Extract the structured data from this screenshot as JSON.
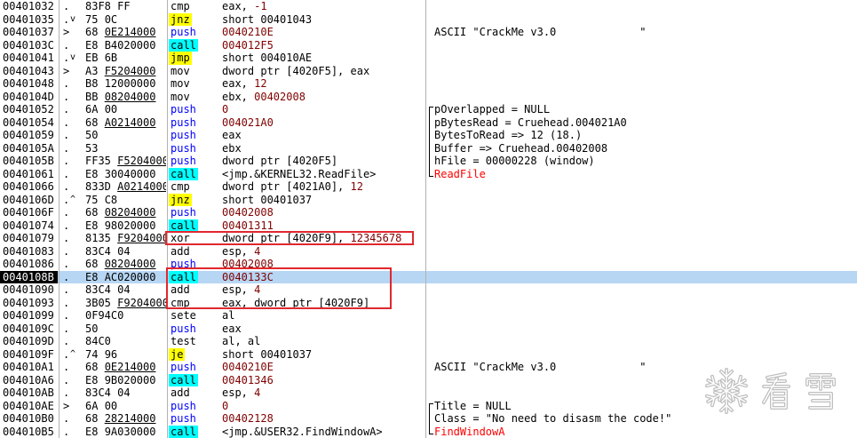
{
  "colors": {
    "push_mnemonic": "#0000FF",
    "call_background": "#00FFFF",
    "jump_background": "#FFFF00",
    "constant_operand": "#800000",
    "api_name_comment": "#FF0000",
    "selected_row": "#B7D6F3",
    "selected_address_background": "#000000",
    "annotation_box": "#E0282E"
  },
  "watermark": {
    "text": "看雪",
    "icon": "snowflake-icon"
  },
  "rows": [
    {
      "addr": "00401032",
      "m": ".",
      "hex": "83F8",
      "arg": "FF",
      "mn": "cmp",
      "ops": "eax, ",
      "imm": "-1"
    },
    {
      "addr": "00401035",
      "m": ".",
      "arr": "down-arrow-icon",
      "hex": "75",
      "arg": "0C",
      "mn": "jnz",
      "ops": "short 00401043",
      "imm": ""
    },
    {
      "addr": "00401037",
      "m": ">",
      "hex": "68",
      "arg": "0E214000",
      "fix": true,
      "mn": "push",
      "ops": "",
      "imm": "0040210E",
      "cmt": "ASCII \"CrackMe v3.0             \""
    },
    {
      "addr": "0040103C",
      "m": ".",
      "hex": "E8",
      "arg": "B4020000",
      "mn": "call",
      "ops": "",
      "imm": "004012F5"
    },
    {
      "addr": "00401041",
      "m": ".",
      "arr": "down-arrow-icon",
      "hex": "EB",
      "arg": "6B",
      "mn": "jmp",
      "ops": "short 004010AE",
      "imm": ""
    },
    {
      "addr": "00401043",
      "m": ">",
      "hex": "A3",
      "arg": "F5204000",
      "fix": true,
      "mn": "mov",
      "ops": "dword ptr [4020F5], eax",
      "imm": ""
    },
    {
      "addr": "00401048",
      "m": ".",
      "hex": "B8",
      "arg": "12000000",
      "mn": "mov",
      "ops": "eax, ",
      "imm": "12"
    },
    {
      "addr": "0040104D",
      "m": ".",
      "hex": "BB",
      "arg": "08204000",
      "fix": true,
      "mn": "mov",
      "ops": "ebx, ",
      "imm": "00402008"
    },
    {
      "addr": "00401052",
      "m": ".",
      "hex": "6A",
      "arg": "00",
      "mn": "push",
      "ops": "",
      "imm": "0",
      "cmt": "pOverlapped = NULL",
      "bracket": true
    },
    {
      "addr": "00401054",
      "m": ".",
      "hex": "68",
      "arg": "A0214000",
      "fix": true,
      "mn": "push",
      "ops": "",
      "imm": "004021A0",
      "cmt": "pBytesRead = Cruehead.004021A0",
      "bracket": true
    },
    {
      "addr": "00401059",
      "m": ".",
      "hex": "50",
      "mn": "push",
      "ops": "eax",
      "imm": "",
      "cmt": "BytesToRead => 12 (18.)",
      "bracket": true
    },
    {
      "addr": "0040105A",
      "m": ".",
      "hex": "53",
      "mn": "push",
      "ops": "ebx",
      "imm": "",
      "cmt": "Buffer => Cruehead.00402008",
      "bracket": true
    },
    {
      "addr": "0040105B",
      "m": ".",
      "hex": "FF35",
      "arg": "F5204000",
      "fix": true,
      "mn": "push",
      "ops": "dword ptr [4020F5]",
      "imm": "",
      "cmt": "hFile = 00000228 (window)",
      "bracket": true
    },
    {
      "addr": "00401061",
      "m": ".",
      "hex": "E8",
      "arg": "30040000",
      "mn": "call",
      "ops": "<jmp.&KERNEL32.ReadFile>",
      "imm": "",
      "cmt": "ReadFile",
      "bracket": true,
      "api": true
    },
    {
      "addr": "00401066",
      "m": ".",
      "hex": "833D",
      "arg": "A0214000",
      "fix": true,
      "mn": "cmp",
      "ops": "dword ptr [4021A0], ",
      "imm": "12"
    },
    {
      "addr": "0040106D",
      "m": ".",
      "arr": "up-arrow-icon",
      "hex": "75",
      "arg": "C8",
      "mn": "jnz",
      "ops": "short 00401037",
      "imm": ""
    },
    {
      "addr": "0040106F",
      "m": ".",
      "hex": "68",
      "arg": "08204000",
      "fix": true,
      "mn": "push",
      "ops": "",
      "imm": "00402008"
    },
    {
      "addr": "00401074",
      "m": ".",
      "hex": "E8",
      "arg": "98020000",
      "mn": "call",
      "ops": "",
      "imm": "00401311"
    },
    {
      "addr": "00401079",
      "m": ".",
      "hex": "8135",
      "arg": "F9204000",
      "fix": true,
      "mn": "xor",
      "ops": "dword ptr [4020F9], ",
      "imm": "12345678"
    },
    {
      "addr": "00401083",
      "m": ".",
      "hex": "83C4",
      "arg": "04",
      "mn": "add",
      "ops": "esp, ",
      "imm": "4"
    },
    {
      "addr": "00401086",
      "m": ".",
      "hex": "68",
      "arg": "08204000",
      "fix": true,
      "mn": "push",
      "ops": "",
      "imm": "00402008"
    },
    {
      "addr": "0040108B",
      "m": ".",
      "hex": "E8",
      "arg": "AC020000",
      "mn": "call",
      "ops": "",
      "imm": "0040133C",
      "sel": true
    },
    {
      "addr": "00401090",
      "m": ".",
      "hex": "83C4",
      "arg": "04",
      "mn": "add",
      "ops": "esp, ",
      "imm": "4"
    },
    {
      "addr": "00401093",
      "m": ".",
      "hex": "3B05",
      "arg": "F9204000",
      "fix": true,
      "mn": "cmp",
      "ops": "eax, dword ptr [4020F9]",
      "imm": ""
    },
    {
      "addr": "00401099",
      "m": ".",
      "hex": "0F94C0",
      "mn": "sete",
      "ops": "al",
      "imm": ""
    },
    {
      "addr": "0040109C",
      "m": ".",
      "hex": "50",
      "mn": "push",
      "ops": "eax",
      "imm": ""
    },
    {
      "addr": "0040109D",
      "m": ".",
      "hex": "84C0",
      "mn": "test",
      "ops": "al, al",
      "imm": ""
    },
    {
      "addr": "0040109F",
      "m": ".",
      "arr": "up-arrow-icon",
      "hex": "74",
      "arg": "96",
      "mn": "je",
      "ops": "short 00401037",
      "imm": ""
    },
    {
      "addr": "004010A1",
      "m": ".",
      "hex": "68",
      "arg": "0E214000",
      "fix": true,
      "mn": "push",
      "ops": "",
      "imm": "0040210E",
      "cmt": "ASCII \"CrackMe v3.0             \""
    },
    {
      "addr": "004010A6",
      "m": ".",
      "hex": "E8",
      "arg": "9B020000",
      "mn": "call",
      "ops": "",
      "imm": "00401346"
    },
    {
      "addr": "004010AB",
      "m": ".",
      "hex": "83C4",
      "arg": "04",
      "mn": "add",
      "ops": "esp, ",
      "imm": "4"
    },
    {
      "addr": "004010AE",
      "m": ">",
      "hex": "6A",
      "arg": "00",
      "mn": "push",
      "ops": "",
      "imm": "0",
      "cmt": "Title = NULL",
      "bracket": true
    },
    {
      "addr": "004010B0",
      "m": ".",
      "hex": "68",
      "arg": "28214000",
      "fix": true,
      "mn": "push",
      "ops": "",
      "imm": "00402128",
      "cmt": "Class = \"No need to disasm the code!\"",
      "bracket": true
    },
    {
      "addr": "004010B5",
      "m": ".",
      "hex": "E8",
      "arg": "9A030000",
      "mn": "call",
      "ops": "<jmp.&USER32.FindWindowA>",
      "imm": "",
      "cmt": "FindWindowA",
      "bracket": true,
      "api": true
    }
  ]
}
